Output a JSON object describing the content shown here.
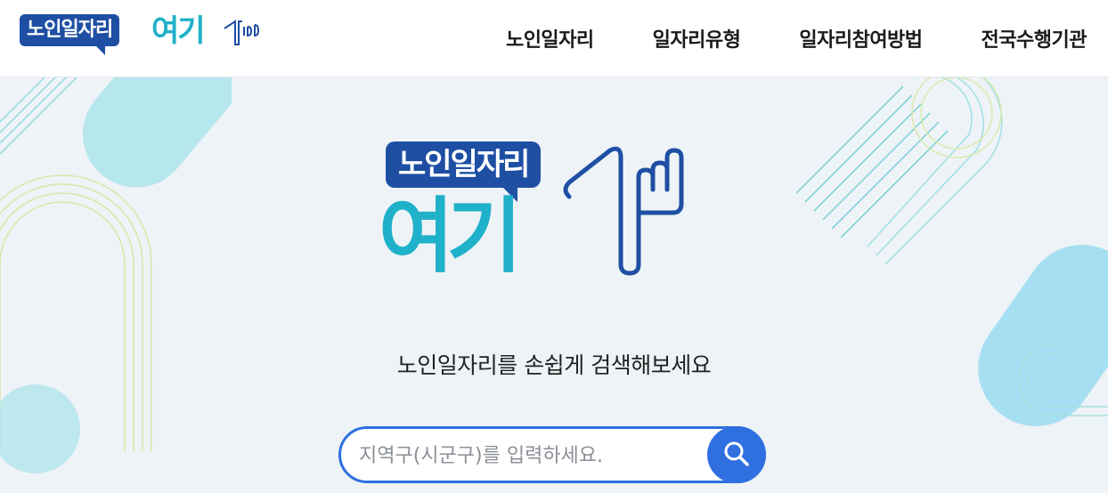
{
  "header": {
    "logo_badge": "노인일자리",
    "logo_word": "여기",
    "nav": [
      {
        "label": "노인일자리"
      },
      {
        "label": "일자리유형"
      },
      {
        "label": "일자리참여방법"
      },
      {
        "label": "전국수행기관"
      }
    ]
  },
  "hero": {
    "logo_badge": "노인일자리",
    "logo_word": "여기",
    "tagline": "노인일자리를 손쉽게 검색해보세요"
  },
  "search": {
    "placeholder": "지역구(시군구)를 입력하세요.",
    "value": "",
    "icon": "search-icon"
  },
  "colors": {
    "brand_blue": "#1e4fa3",
    "brand_teal": "#1fb1c9",
    "accent": "#2f6fe0"
  }
}
